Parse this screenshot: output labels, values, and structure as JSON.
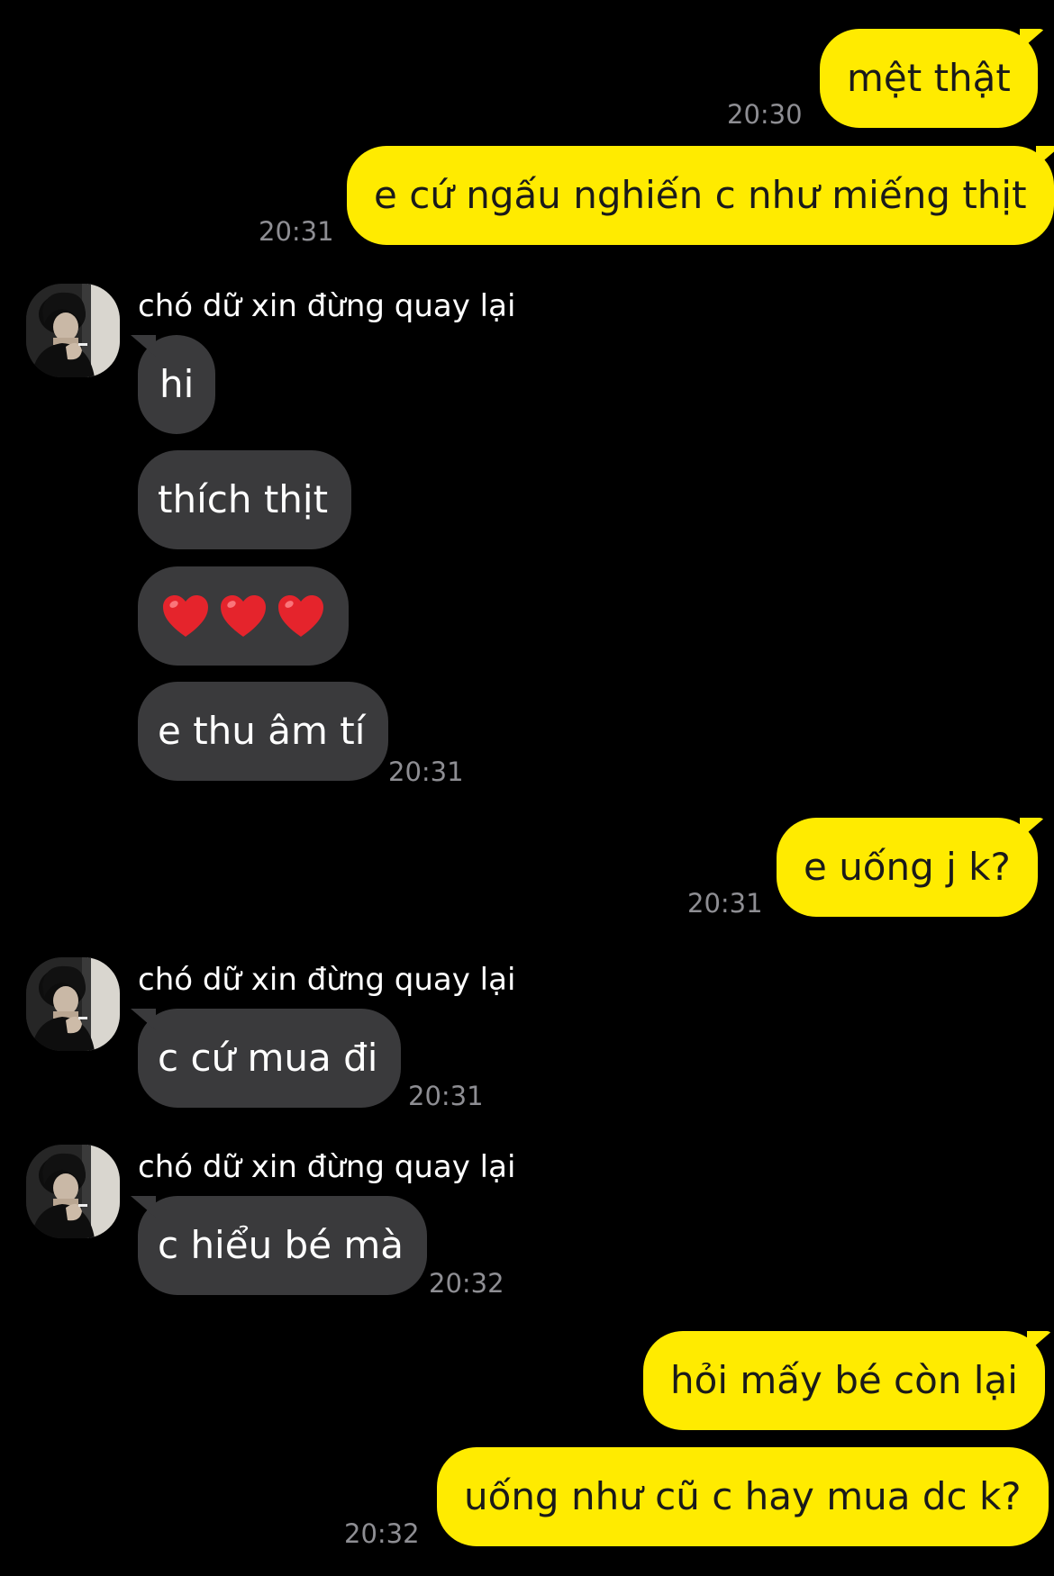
{
  "contact": {
    "name": "chó dữ xin đừng quay lại"
  },
  "colors": {
    "background": "#000000",
    "outgoing_bubble": "#FFEB00",
    "incoming_bubble": "#3A3A3C",
    "timestamp": "#8E8E93"
  },
  "messages": [
    {
      "direction": "out",
      "text": "mệt thật",
      "time": "20:30"
    },
    {
      "direction": "out",
      "text": "e cứ ngấu nghiến c như miếng thịt",
      "time": "20:31"
    },
    {
      "direction": "in",
      "text": "hi"
    },
    {
      "direction": "in",
      "text": "thích thịt"
    },
    {
      "direction": "in",
      "emoji": "heart-icon ×3"
    },
    {
      "direction": "in",
      "text": "e thu âm tí",
      "time": "20:31"
    },
    {
      "direction": "out",
      "text": "e uống j k?",
      "time": "20:31"
    },
    {
      "direction": "in",
      "text": "c cứ mua đi",
      "time": "20:31"
    },
    {
      "direction": "in",
      "text": "c hiểu bé mà",
      "time": "20:32"
    },
    {
      "direction": "out",
      "text": "hỏi mấy bé còn lại"
    },
    {
      "direction": "out",
      "text": "uống như cũ c hay mua dc k?",
      "time": "20:32"
    }
  ]
}
